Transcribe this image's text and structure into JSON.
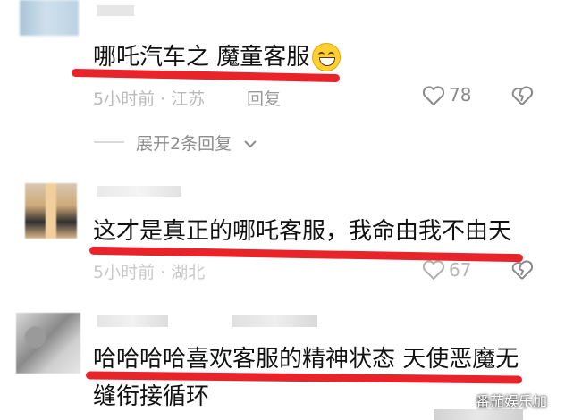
{
  "comments": [
    {
      "text": "哪吒汽车之 魔童客服",
      "emoji": "grinning-squint-emoji",
      "meta": "5小时前 · 江苏",
      "reply_label": "回复",
      "likes": "78",
      "expand_label": "展开2条回复"
    },
    {
      "text": "这才是真正的哪吒客服，我命由我不由天",
      "meta": "5小时前 · 湖北",
      "likes": "67"
    },
    {
      "text_line1": "哈哈哈哈喜欢客服的精神状态 天使恶魔无",
      "text_line2": "缝衔接循环"
    }
  ],
  "watermark": "番茄娱乐加",
  "colors": {
    "underline": "#e8232a",
    "meta_text": "#b9b9b9",
    "icon_gray": "#8a8a8a"
  }
}
